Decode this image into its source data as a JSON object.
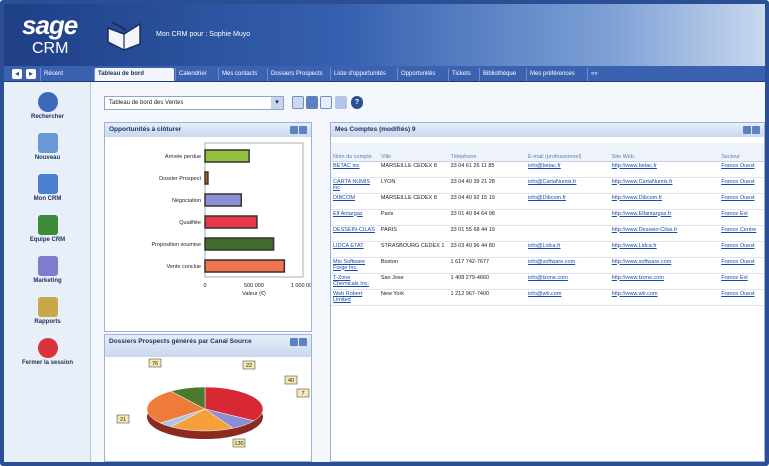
{
  "header": {
    "brand_top": "sage",
    "brand_bottom": "CRM",
    "title": "Mon CRM pour : Sophie Muyo"
  },
  "tabs": [
    {
      "label": "Tableau de bord",
      "active": true
    },
    {
      "label": "Calendrier"
    },
    {
      "label": "Mes contacts"
    },
    {
      "label": "Dossiers Prospects"
    },
    {
      "label": "Liste d'opportunités"
    },
    {
      "label": "Opportunités"
    },
    {
      "label": "Tickets"
    },
    {
      "label": "Bibliothèque"
    },
    {
      "label": "Mes préférences"
    },
    {
      "label": "«»"
    }
  ],
  "sidebar": [
    {
      "label": "Rechercher",
      "icon": "magnifier-icon"
    },
    {
      "label": "Nouveau",
      "icon": "new-document-icon"
    },
    {
      "label": "Mon CRM",
      "icon": "book-icon"
    },
    {
      "label": "Equipe CRM",
      "icon": "team-icon"
    },
    {
      "label": "Marketing",
      "icon": "marketing-icon"
    },
    {
      "label": "Rapports",
      "icon": "report-icon"
    },
    {
      "label": "Fermer la session",
      "icon": "close-session-icon"
    }
  ],
  "toolbar": {
    "dashboard_select": "Tableau de bord des Ventes"
  },
  "panels": {
    "opps": "Opportunités à clôturer",
    "accounts": "Mes Comptes (modifiés) 9",
    "prospects": "Dossiers Prospects générés par Canal Source"
  },
  "chart_data": [
    {
      "type": "bar",
      "title": "Opportunités à clôturer",
      "categories": [
        "Arrivée perdue",
        "Dossier Prospect",
        "Négociation",
        "Qualifiée",
        "Proposition soumise",
        "Vente conclue"
      ],
      "values": [
        450000,
        30000,
        370000,
        530000,
        700000,
        810000
      ],
      "xlabel": "Valeur (€)",
      "xticks": [
        "0",
        "500 000",
        "1 000 000"
      ],
      "xlim": [
        0,
        1000000
      ],
      "colors": [
        "#8fc13d",
        "#b4632a",
        "#8c8fd6",
        "#e8374b",
        "#3f6b2c",
        "#f0744c"
      ]
    },
    {
      "type": "pie",
      "title": "Dossiers Prospects générés par Canal Source",
      "labels": [
        "76",
        "22",
        "40",
        "7",
        "130",
        "21"
      ],
      "colors": [
        "#d82834",
        "#8c8fd6",
        "#f5a03a",
        "#b0c4e8",
        "#f07a3a",
        "#4a7a2c"
      ]
    }
  ],
  "table": {
    "headers": [
      "Nom du compte",
      "Ville",
      "Téléphone",
      "E-mail (professionnel)",
      "Site Web",
      "Secteur"
    ],
    "rows": [
      [
        "BETAC inc",
        "MARSEILLE CEDEX 8",
        "33 04 61 26 11 85",
        "info@betac.fr",
        "http://www.betac.fr",
        "France Ouest"
      ],
      [
        "CARTA NUMIS inc",
        "LYON",
        "33 04 40 39 21 28",
        "info@CartaNumis.fr",
        "http://www.CartaNumis.fr",
        "France Ouest"
      ],
      [
        "DIBCOM",
        "MARSEILLE CEDEX 8",
        "33 04 40 92 15 19",
        "info@Dibcom.fr",
        "http://www.Dibcom.fr",
        "France Ouest"
      ],
      [
        "Elf Antargaz",
        "Paris",
        "33 01 40 84 64 98",
        "",
        "http://www.Elfantargaz.fr",
        "France Est"
      ],
      [
        "DESSEIN-CILAS",
        "PARIS",
        "33 01 55 68 44 19",
        "",
        "http://www.Dessein-Cilas.fr",
        "France Centre"
      ],
      [
        "LIDCA ETAT",
        "STRASBOURG CEDEX 1",
        "33 03 40 96 44 80",
        "info@Lidca.fr",
        "http://www.Lidca.fr",
        "France Ouest"
      ],
      [
        "Mio Software Forge Inc.",
        "Boston",
        "1 617 742-7677",
        "info@software.com",
        "http://www.software.com",
        "France Ouest"
      ],
      [
        "T-Zone Chemicals Inc.",
        "San Jose",
        "1 408 279-4660",
        "info@tzone.com",
        "http://www.tzone.com",
        "France Est"
      ],
      [
        "Web Robert Limited",
        "New York",
        "1 212 967-7400",
        "info@wb.com",
        "http://www.wb.com",
        "France Ouest"
      ]
    ]
  }
}
